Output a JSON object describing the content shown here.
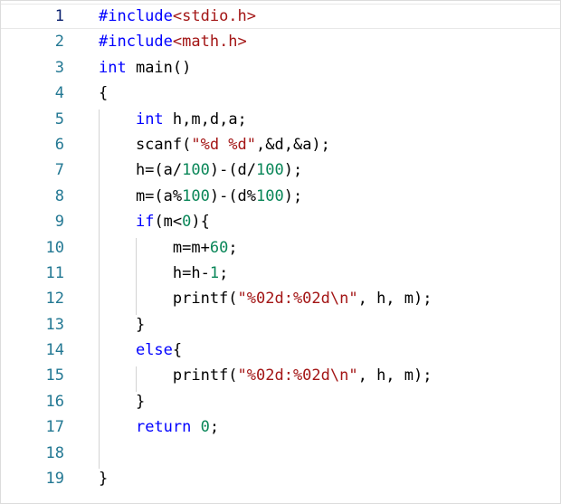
{
  "editor": {
    "lines": [
      {
        "n": "1",
        "tokens": [
          [
            "pp",
            "#include"
          ],
          [
            "inc",
            "<stdio.h>"
          ]
        ]
      },
      {
        "n": "2",
        "tokens": [
          [
            "pp",
            "#include"
          ],
          [
            "inc",
            "<math.h>"
          ]
        ]
      },
      {
        "n": "3",
        "tokens": [
          [
            "kw",
            "int"
          ],
          [
            "txt",
            " main()"
          ]
        ]
      },
      {
        "n": "4",
        "tokens": [
          [
            "txt",
            "{"
          ]
        ]
      },
      {
        "n": "5",
        "tokens": [
          [
            "txt",
            "    "
          ],
          [
            "kw",
            "int"
          ],
          [
            "txt",
            " h,m,d,a;"
          ]
        ]
      },
      {
        "n": "6",
        "tokens": [
          [
            "txt",
            "    scanf("
          ],
          [
            "str",
            "\"%d %d\""
          ],
          [
            "txt",
            ",&d,&a);"
          ]
        ]
      },
      {
        "n": "7",
        "tokens": [
          [
            "txt",
            "    h=(a/"
          ],
          [
            "num",
            "100"
          ],
          [
            "txt",
            ")-(d/"
          ],
          [
            "num",
            "100"
          ],
          [
            "txt",
            ");"
          ]
        ]
      },
      {
        "n": "8",
        "tokens": [
          [
            "txt",
            "    m=(a%"
          ],
          [
            "num",
            "100"
          ],
          [
            "txt",
            ")-(d%"
          ],
          [
            "num",
            "100"
          ],
          [
            "txt",
            ");"
          ]
        ]
      },
      {
        "n": "9",
        "tokens": [
          [
            "txt",
            "    "
          ],
          [
            "kw",
            "if"
          ],
          [
            "txt",
            "(m<"
          ],
          [
            "num",
            "0"
          ],
          [
            "txt",
            "){"
          ]
        ]
      },
      {
        "n": "10",
        "tokens": [
          [
            "txt",
            "        m=m+"
          ],
          [
            "num",
            "60"
          ],
          [
            "txt",
            ";"
          ]
        ]
      },
      {
        "n": "11",
        "tokens": [
          [
            "txt",
            "        h=h-"
          ],
          [
            "num",
            "1"
          ],
          [
            "txt",
            ";"
          ]
        ]
      },
      {
        "n": "12",
        "tokens": [
          [
            "txt",
            "        printf("
          ],
          [
            "str",
            "\"%02d:%02d\\n\""
          ],
          [
            "txt",
            ", h, m);"
          ]
        ]
      },
      {
        "n": "13",
        "tokens": [
          [
            "txt",
            "    }"
          ]
        ]
      },
      {
        "n": "14",
        "tokens": [
          [
            "txt",
            "    "
          ],
          [
            "kw",
            "else"
          ],
          [
            "txt",
            "{"
          ]
        ]
      },
      {
        "n": "15",
        "tokens": [
          [
            "txt",
            "        printf("
          ],
          [
            "str",
            "\"%02d:%02d\\n\""
          ],
          [
            "txt",
            ", h, m);"
          ]
        ]
      },
      {
        "n": "16",
        "tokens": [
          [
            "txt",
            "    }"
          ]
        ]
      },
      {
        "n": "17",
        "tokens": [
          [
            "txt",
            "    "
          ],
          [
            "kw",
            "return"
          ],
          [
            "txt",
            " "
          ],
          [
            "num",
            "0"
          ],
          [
            "txt",
            ";"
          ]
        ]
      },
      {
        "n": "18",
        "tokens": []
      },
      {
        "n": "19",
        "tokens": [
          [
            "txt",
            "}"
          ]
        ]
      }
    ],
    "colors": {
      "keyword": "#0000ff",
      "string": "#a31515",
      "number": "#098658",
      "line_number": "#237893"
    }
  }
}
